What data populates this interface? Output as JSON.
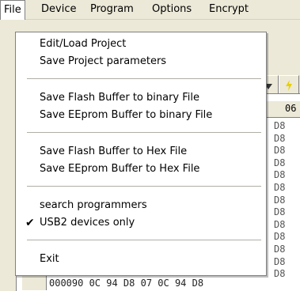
{
  "menubar": {
    "items": [
      {
        "label": "File"
      },
      {
        "label": "Device"
      },
      {
        "label": "Program"
      },
      {
        "label": "Options"
      },
      {
        "label": "Encrypt"
      }
    ]
  },
  "file_menu": {
    "items": [
      {
        "label": "Edit/Load Project"
      },
      {
        "label": "Save Project parameters"
      },
      {
        "label": "Save Flash Buffer to binary File"
      },
      {
        "label": "Save EEprom Buffer to binary File"
      },
      {
        "label": "Save Flash Buffer to Hex File"
      },
      {
        "label": "Save EEprom Buffer to Hex File"
      },
      {
        "label": "search programmers"
      },
      {
        "label": "USB2 devices only",
        "checked": true,
        "check_mark": "✔"
      },
      {
        "label": "Exit"
      }
    ]
  },
  "hex_view": {
    "header_label": "06",
    "column_values": [
      "D8",
      "D8",
      "D8",
      "D8",
      "D8",
      "D8",
      "D8",
      "D8",
      "D8",
      "D8",
      "D8",
      "D8",
      "D8"
    ],
    "last_row": "000090 0C 94 D8 07 0C 94 D8"
  },
  "toolbar_icons": [
    "arrow-down-icon",
    "lightning-icon"
  ]
}
